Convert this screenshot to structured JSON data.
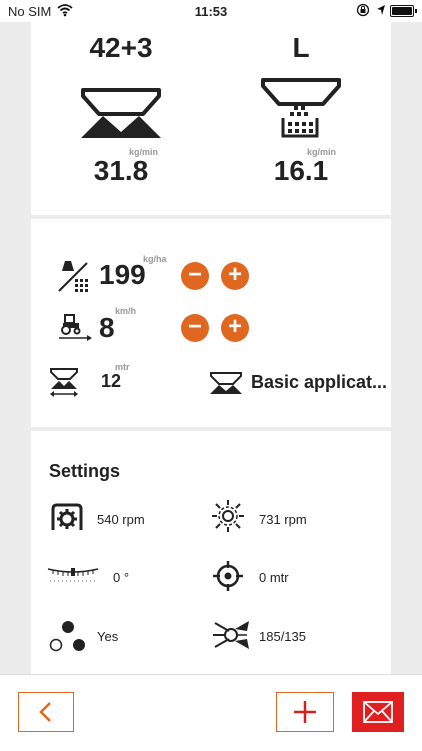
{
  "status_bar": {
    "carrier": "No SIM",
    "time": "11:53"
  },
  "spreader": {
    "left": {
      "mode": "42+3",
      "unit": "kg/min",
      "flow": "31.8"
    },
    "right": {
      "mode": "L",
      "unit": "kg/min",
      "flow": "16.1"
    }
  },
  "controls": {
    "application_rate": {
      "value": "199",
      "unit": "kg/ha"
    },
    "speed": {
      "value": "8",
      "unit": "km/h"
    },
    "width": {
      "value": "12",
      "unit": "mtr"
    },
    "application_type": "Basic applicat..."
  },
  "settings": {
    "title": "Settings",
    "items": {
      "pto": "540 rpm",
      "disc": "731 rpm",
      "angle": "0 °",
      "offset": "0 mtr",
      "vanes": "Yes",
      "vane_set": "185/135"
    }
  },
  "bottom_bar": {
    "back_icon": "chevron-left-icon",
    "add_icon": "plus-icon",
    "mail_icon": "envelope-icon"
  },
  "colors": {
    "accent": "#e0671f",
    "mail_bg": "#e02020",
    "background": "#ececec"
  }
}
